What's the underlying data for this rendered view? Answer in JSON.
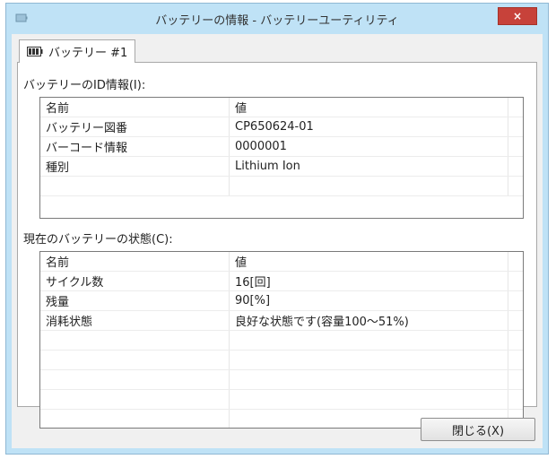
{
  "window": {
    "title": "バッテリーの情報 - バッテリーユーティリティ",
    "close_glyph": "×"
  },
  "tab": {
    "label": "バッテリー #1",
    "icon": "battery-icon"
  },
  "id_section": {
    "label": "バッテリーのID情報(I):",
    "header": {
      "name": "名前",
      "value": "値"
    },
    "rows": [
      {
        "name": "バッテリー図番",
        "value": "CP650624-01"
      },
      {
        "name": "バーコード情報",
        "value": "0000001"
      },
      {
        "name": "種別",
        "value": "Lithium Ion"
      }
    ]
  },
  "status_section": {
    "label": "現在のバッテリーの状態(C):",
    "header": {
      "name": "名前",
      "value": "値"
    },
    "rows": [
      {
        "name": "サイクル数",
        "value": "16[回]"
      },
      {
        "name": "残量",
        "value": "90[%]"
      },
      {
        "name": "消耗状態",
        "value": "良好な状態です(容量100～51%)"
      }
    ]
  },
  "buttons": {
    "close_label": "閉じる(X)"
  }
}
